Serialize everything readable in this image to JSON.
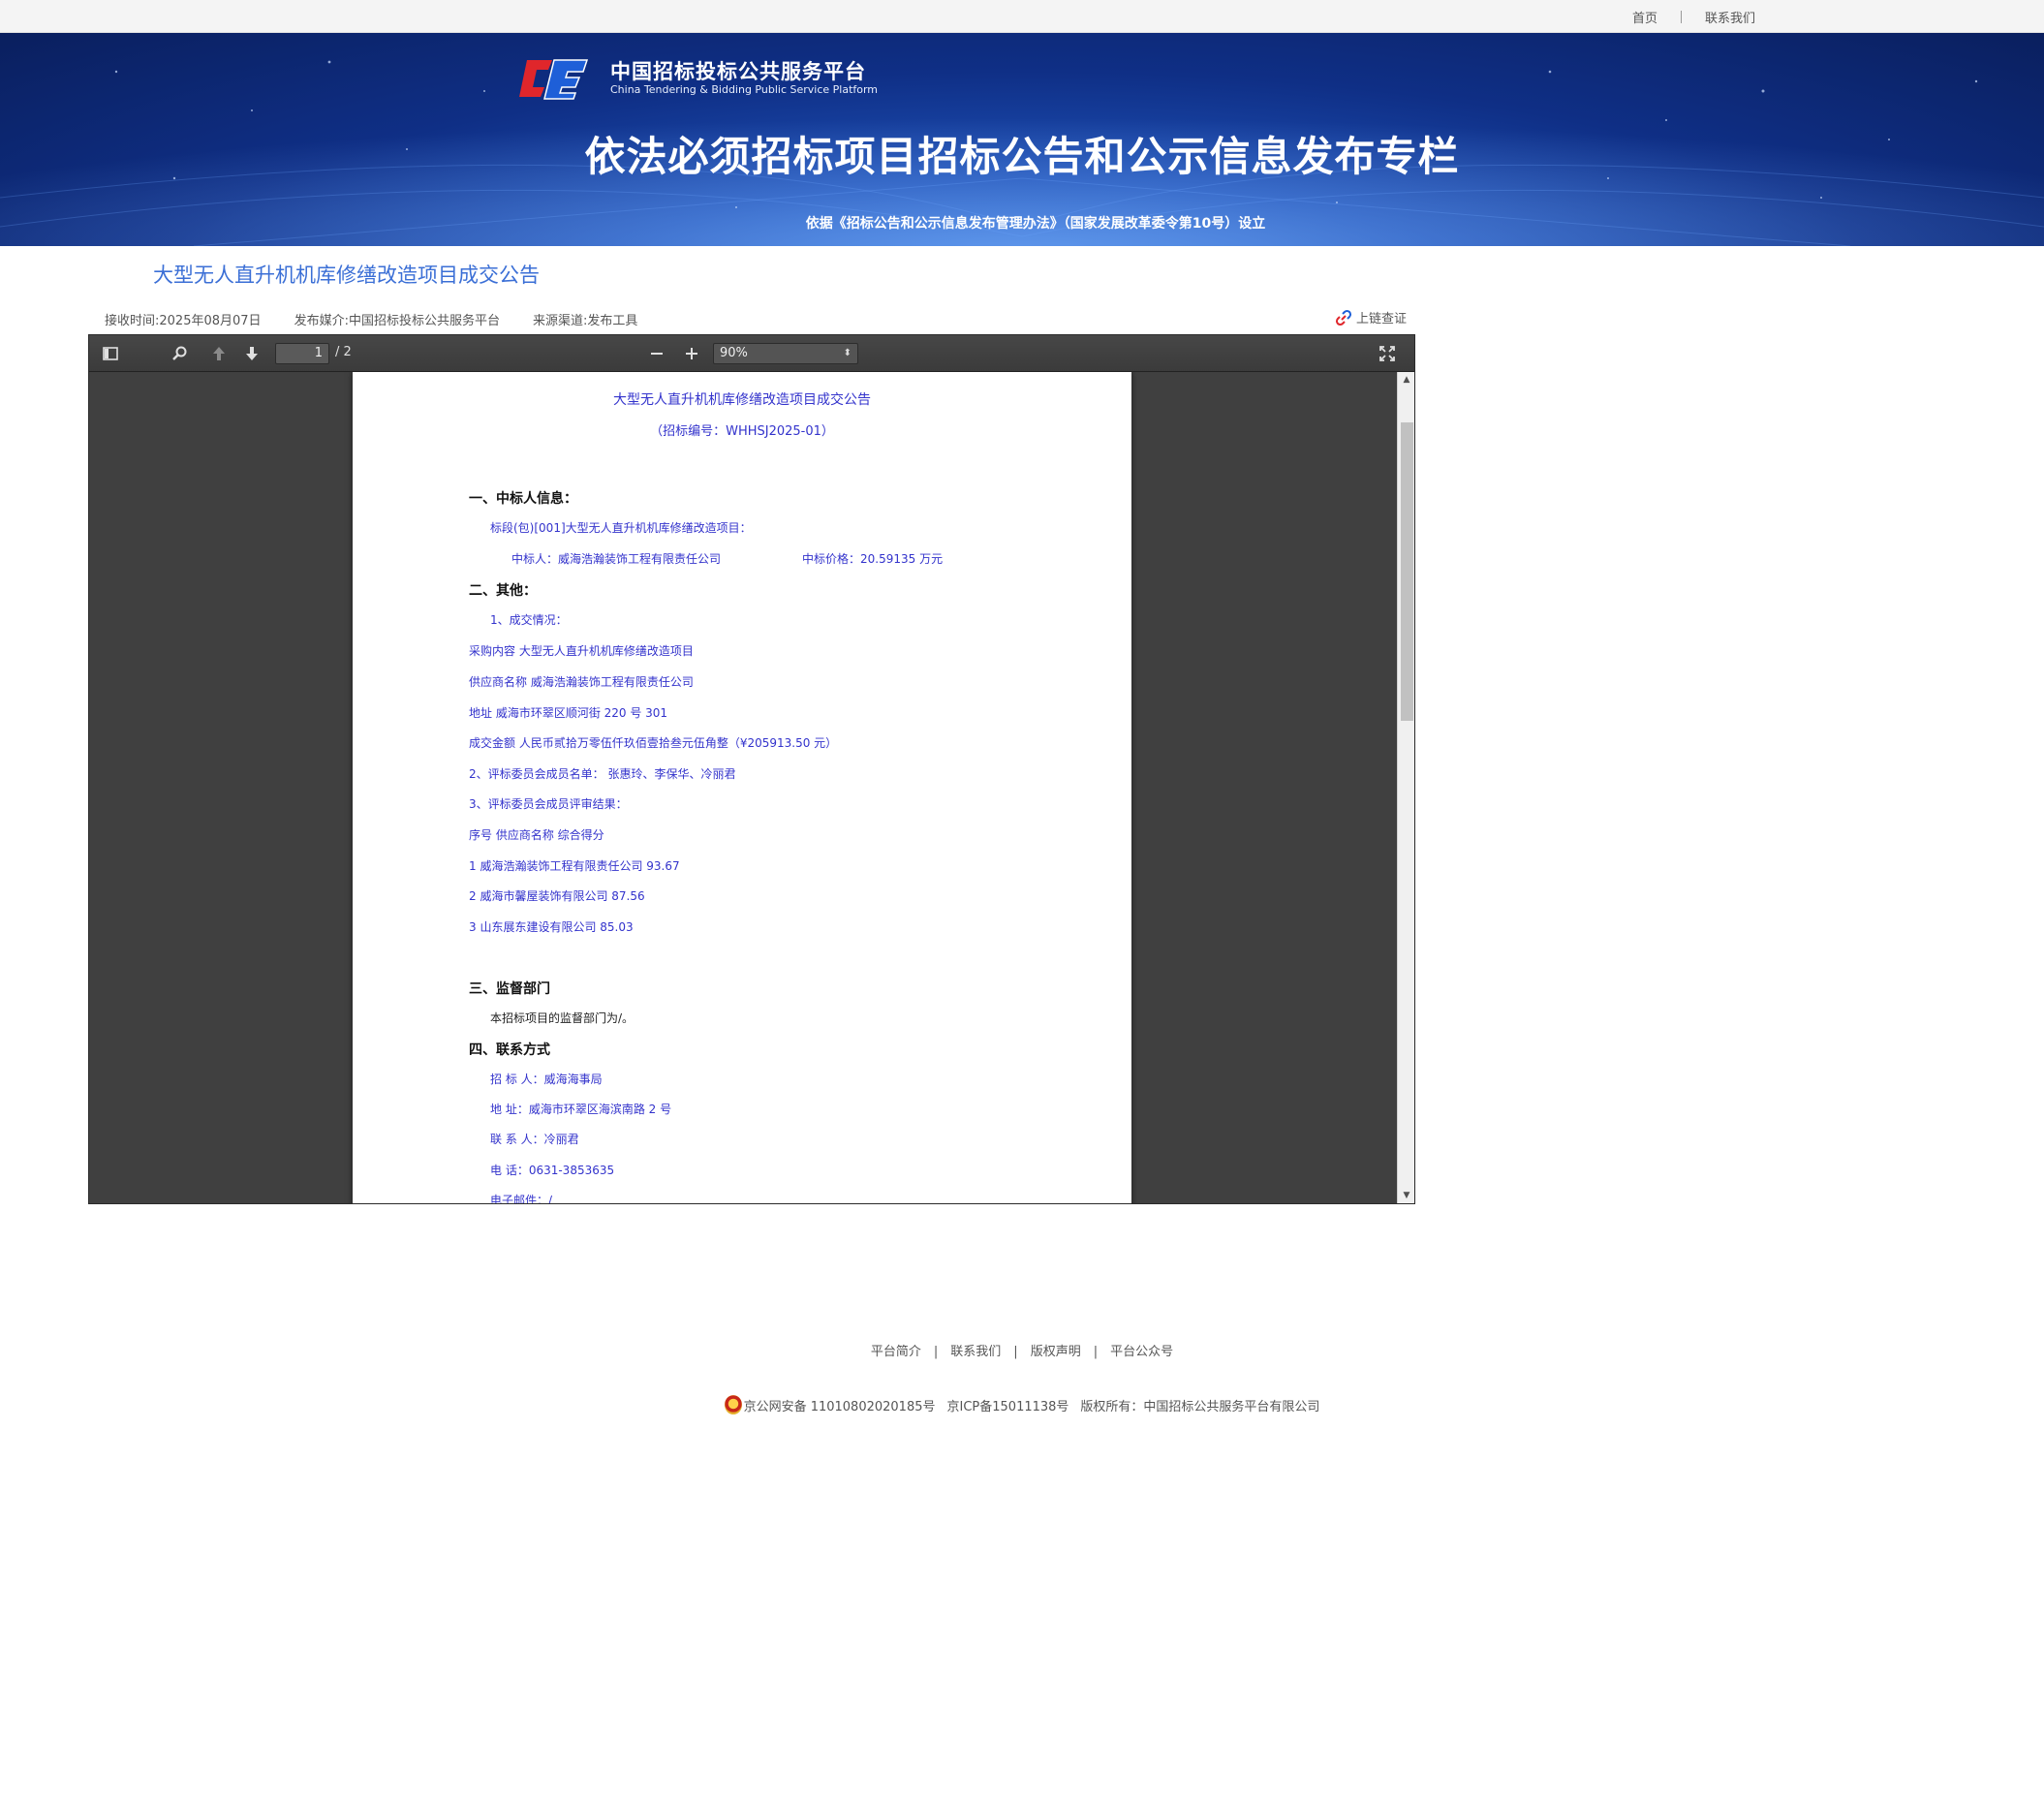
{
  "topnav": {
    "home": "首页",
    "contact": "联系我们"
  },
  "banner": {
    "logo_cn": "中国招标投标公共服务平台",
    "logo_en": "China Tendering & Bidding Public Service Platform",
    "title": "依法必须招标项目招标公告和公示信息发布专栏",
    "subtitle": "依据《招标公告和公示信息发布管理办法》（国家发展改革委令第10号）设立"
  },
  "article": {
    "title": "大型无人直升机机库修缮改造项目成交公告",
    "received": "接收时间:2025年08月07日",
    "media": "发布媒介:中国招标投标公共服务平台",
    "source": "来源渠道:发布工具",
    "chain": "上链查证"
  },
  "viewer": {
    "page_current": "1",
    "page_total": "/ 2",
    "zoom": "90%",
    "icons": [
      "sidebar-toggle-icon",
      "search-icon",
      "prev-page-icon",
      "next-page-icon",
      "zoom-out-icon",
      "zoom-in-icon",
      "fullscreen-icon"
    ]
  },
  "pdf": {
    "title": "大型无人直升机机库修缮改造项目成交公告",
    "code": "（招标编号：WHHSJ2025-01）",
    "s1": "一、中标人信息：",
    "lot": "标段(包)[001]大型无人直升机机库修缮改造项目：",
    "winner": "中标人：威海浩瀚装饰工程有限责任公司",
    "price": "中标价格：20.59135 万元",
    "s2": "二、其他：",
    "deal": "1、成交情况：",
    "content": "采购内容 大型无人直升机机库修缮改造项目",
    "supplier": "供应商名称 威海浩瀚装饰工程有限责任公司",
    "address": "地址 威海市环翠区顺河街 220 号 301",
    "amount": "成交金额 人民币贰拾万零伍仟玖佰壹拾叁元伍角整（¥205913.50 元）",
    "committee": "2、评标委员会成员名单： 张惠玲、李保华、冷丽君",
    "results": "3、评标委员会成员评审结果：",
    "thead": "序号 供应商名称 综合得分",
    "row1": "1 威海浩瀚装饰工程有限责任公司 93.67",
    "row2": "2 威海市馨屋装饰有限公司 87.56",
    "row3": "3 山东展东建设有限公司 85.03",
    "s3": "三、监督部门",
    "supervise": "本招标项目的监督部门为/。",
    "s4": "四、联系方式",
    "c_tenderer": "招 标 人：威海海事局",
    "c_address": "地     址：威海市环翠区海滨南路 2 号",
    "c_person": "联 系 人：冷丽君",
    "c_phone": "电     话：0631-3853635",
    "c_email": "电子邮件：/"
  },
  "footer": {
    "links": [
      "平台简介",
      "联系我们",
      "版权声明",
      "平台公众号"
    ],
    "police": "京公网安备 11010802020185号",
    "icp": "京ICP备15011138号",
    "copyright": "版权所有：中国招标公共服务平台有限公司"
  }
}
